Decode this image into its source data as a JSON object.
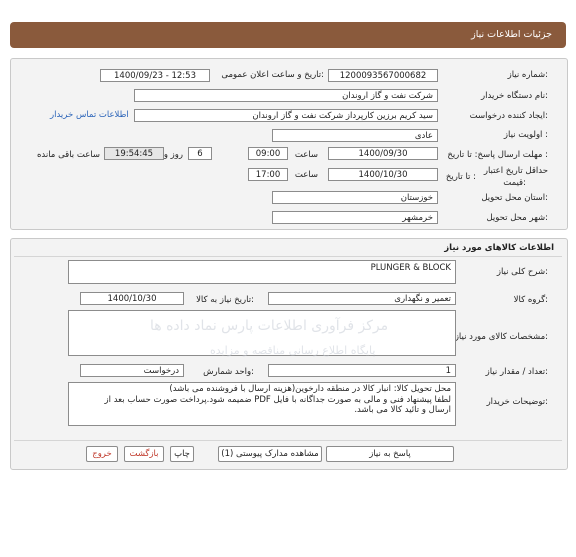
{
  "header": {
    "title": "جزئیات اطلاعات نیاز"
  },
  "info": {
    "need_number_label": "شماره نیاز:",
    "need_number": "1200093567000682",
    "announce_label": "تاریخ و ساعت اعلان عمومی:",
    "announce_value": "1400/09/23 - 12:53",
    "buyer_org_label": "نام دستگاه خریدار:",
    "buyer_org": "شرکت نفت و گاز اروندان",
    "creator_label": "ایجاد کننده درخواست:",
    "creator": "سید کریم برزین کارپرداز شرکت نفت و گاز اروندان",
    "contact_link": "اطلاعات تماس خریدار",
    "priority_label": "اولویت نیاز :",
    "priority": "عادی",
    "deadline_label": "مهلت ارسال پاسخ: تا تاریخ :",
    "deadline_date": "1400/09/30",
    "time_label": "ساعت",
    "deadline_time": "09:00",
    "days": "6",
    "days_label": "روز و",
    "remaining_time": "19:54:45",
    "remaining_label": "ساعت باقی مانده",
    "validity_label_1": "حداقل تاریخ اعتبار",
    "validity_label_2": "قیمت:",
    "validity_to_label": "تا تاریخ :",
    "validity_date": "1400/10/30",
    "validity_time_label": "ساعت",
    "validity_time": "17:00",
    "province_label": "استان محل تحویل:",
    "province": "خوزستان",
    "city_label": "شهر محل تحویل:",
    "city": "خرمشهر"
  },
  "goods": {
    "section_title": "اطلاعات کالاهای مورد نیاز",
    "summary_label": "شرح کلی نیاز:",
    "summary": "PLUNGER & BLOCK",
    "group_label": "گروه کالا:",
    "group": "تعمیر و نگهداری",
    "need_date_label": "تاریخ نیاز به کالا:",
    "need_date": "1400/10/30",
    "specs_label": "مشخصات کالای مورد نیاز:",
    "specs": "",
    "qty_label": "تعداد / مقدار نیاز:",
    "qty": "1",
    "unit_label": "واحد شمارش:",
    "unit": "درخواست",
    "notes_label": "توضیحات خریدار:",
    "notes_1": "محل تحویل کالا: انبار کالا در منطقه دارخوین(هزینه ارسال با فروشنده می باشد)",
    "notes_2": "لطفا پیشنهاد فنی و مالی به صورت جداگانه با فایل PDF ضمیمه شود.پرداخت صورت حساب بعد از",
    "notes_3": "ارسال و تائید کالا می باشد."
  },
  "buttons": {
    "reply": "پاسخ به نیاز",
    "attachments": "مشاهده مدارک پیوستی (1)",
    "print": "چاپ",
    "back": "بازگشت",
    "exit": "خروج"
  },
  "watermark": {
    "line_1": "مرکز فرآوری اطلاعات پارس نماد داده ها",
    "line_2": "پایگاه اطلاع رسانی مناقصه و مزایده"
  }
}
